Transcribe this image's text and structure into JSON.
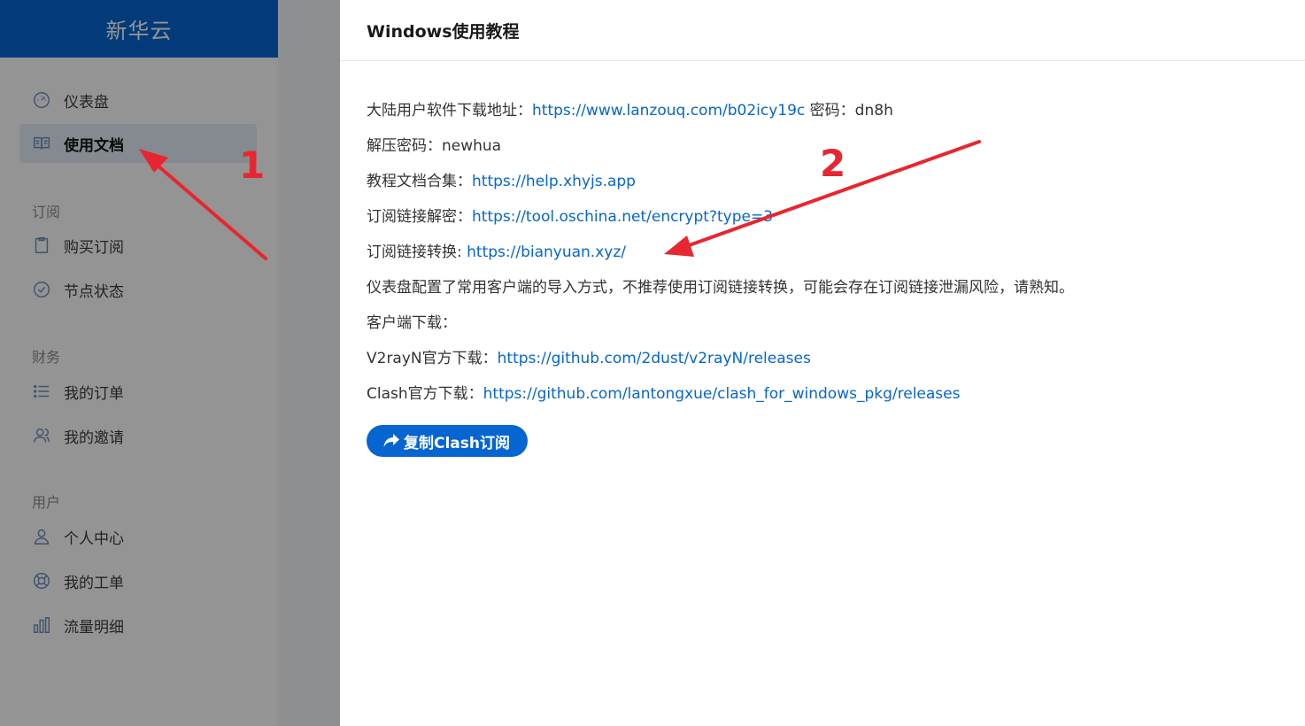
{
  "brand": {
    "title": "新华云"
  },
  "sidebar": {
    "items": [
      {
        "label": "仪表盘",
        "icon": "dashboard-icon"
      },
      {
        "label": "使用文档",
        "icon": "book-icon",
        "active": true
      }
    ],
    "groups": [
      {
        "title": "订阅",
        "items": [
          {
            "label": "购买订阅",
            "icon": "clipboard-icon"
          },
          {
            "label": "节点状态",
            "icon": "check-circle-icon"
          }
        ]
      },
      {
        "title": "财务",
        "items": [
          {
            "label": "我的订单",
            "icon": "list-icon"
          },
          {
            "label": "我的邀请",
            "icon": "users-icon"
          }
        ]
      },
      {
        "title": "用户",
        "items": [
          {
            "label": "个人中心",
            "icon": "user-icon"
          },
          {
            "label": "我的工单",
            "icon": "lifebuoy-icon"
          },
          {
            "label": "流量明细",
            "icon": "bar-chart-icon"
          }
        ]
      }
    ]
  },
  "panel": {
    "title": "Windows使用教程",
    "lines": [
      {
        "text": "大陆用户软件下载地址：",
        "link": "https://www.lanzouq.com/b02icy19c",
        "suffix": " 密码：dn8h"
      },
      {
        "text": "解压密码：newhua"
      },
      {
        "text": "教程文档合集：",
        "link": "https://help.xhyjs.app"
      },
      {
        "text": "订阅链接解密：",
        "link": "https://tool.oschina.net/encrypt?type=3"
      },
      {
        "text": "订阅链接转换: ",
        "link": "https://bianyuan.xyz/"
      },
      {
        "text": "仪表盘配置了常用客户端的导入方式，不推荐使用订阅链接转换，可能会存在订阅链接泄漏风险，请熟知。"
      },
      {
        "text": "客户端下载："
      },
      {
        "text": "V2rayN官方下载：",
        "link": "https://github.com/2dust/v2rayN/releases"
      },
      {
        "text": "Clash官方下载：",
        "link": "https://github.com/lantongxue/clash_for_windows_pkg/releases"
      }
    ],
    "copy_button": "复制Clash订阅",
    "share_icon": "share-icon"
  },
  "annotations": {
    "marker_1": "1",
    "marker_2": "2",
    "color": "#e8262f"
  },
  "colors": {
    "accent": "#0665d0",
    "overlay": "rgba(0,0,0,0.42)"
  }
}
